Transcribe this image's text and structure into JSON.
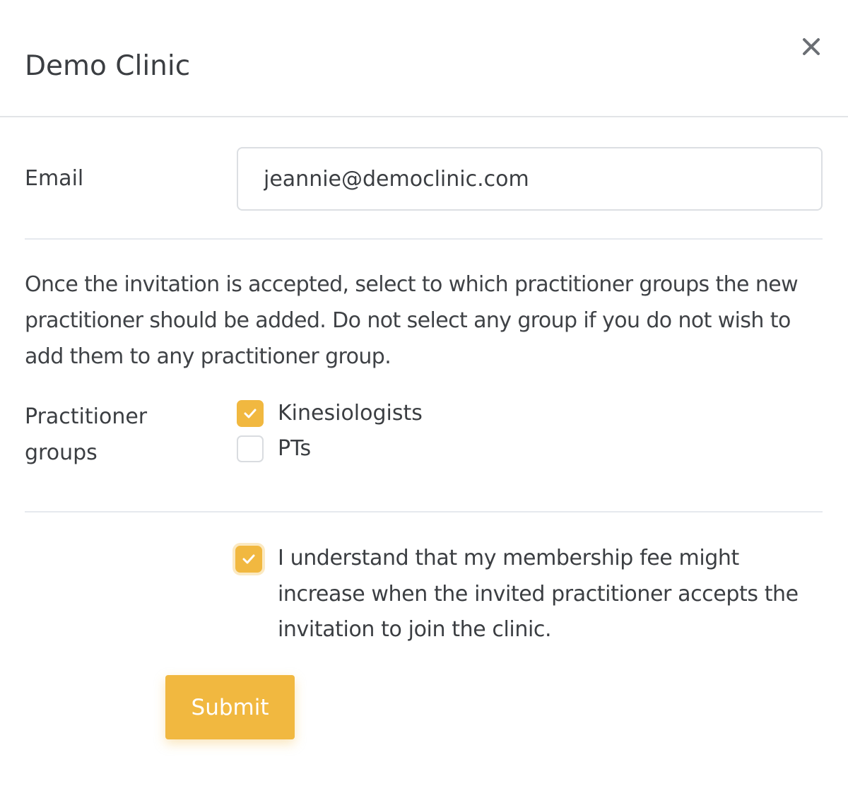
{
  "modal": {
    "title": "Demo Clinic",
    "close_icon": "close-icon"
  },
  "email": {
    "label": "Email",
    "value": "jeannie@democlinic.com"
  },
  "help_text": "Once the invitation is accepted, select to which practitioner groups the new practitioner should be added. Do not select any group if you do not wish to add them to any practitioner group.",
  "practitioner_groups": {
    "label": "Practitioner groups",
    "options": [
      {
        "label": "Kinesiologists",
        "checked": true
      },
      {
        "label": "PTs",
        "checked": false
      }
    ]
  },
  "acknowledgement": {
    "text": "I understand that my membership fee might increase when the invited practitioner accepts the invitation to join the clinic.",
    "checked": true
  },
  "submit": {
    "label": "Submit"
  },
  "colors": {
    "accent": "#f1b840",
    "text": "#3b3e42",
    "border": "#dcdfe3"
  },
  "icons": {
    "close": "close-icon",
    "check": "check-icon"
  }
}
